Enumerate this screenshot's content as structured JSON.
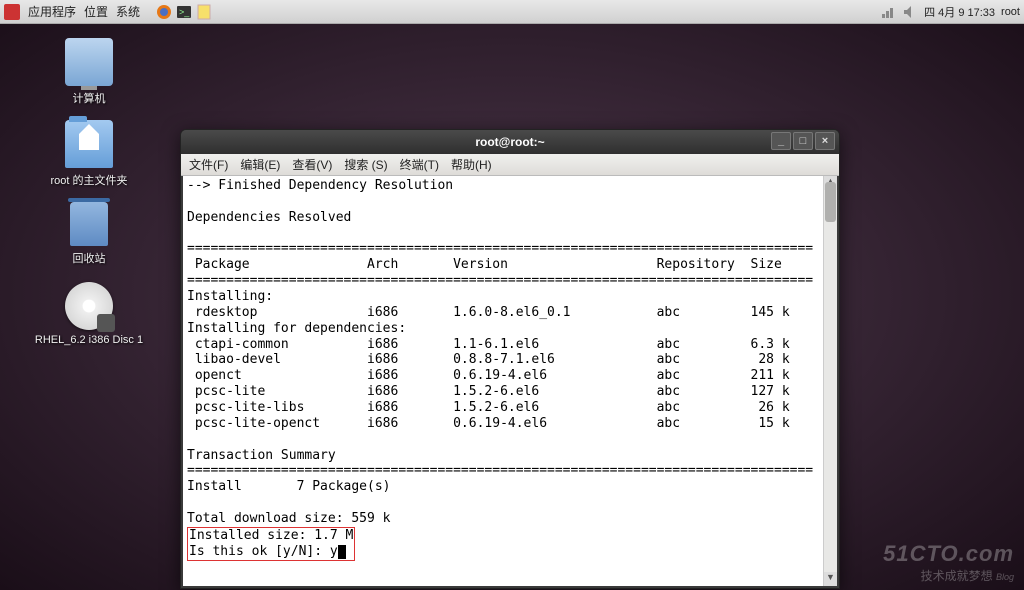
{
  "taskbar": {
    "menu": {
      "apps": "应用程序",
      "places": "位置",
      "system": "系统"
    },
    "clock": "四  4月  9 17:33",
    "user": "root"
  },
  "desktop": {
    "computer": "计算机",
    "home": "root 的主文件夹",
    "trash": "回收站",
    "dvd": "RHEL_6.2 i386 Disc 1"
  },
  "window": {
    "title": "root@root:~",
    "menu": {
      "file": "文件(F)",
      "edit": "编辑(E)",
      "view": "查看(V)",
      "search": "搜索 (S)",
      "terminal": "终端(T)",
      "help": "帮助(H)"
    }
  },
  "terminal": {
    "line_finish": "--> Finished Dependency Resolution",
    "deps_resolved": "Dependencies Resolved",
    "hdr": {
      "pkg": "Package",
      "arch": "Arch",
      "ver": "Version",
      "repo": "Repository",
      "size": "Size"
    },
    "install_hdr": "Installing:",
    "install_dep_hdr": "Installing for dependencies:",
    "rows": [
      {
        "p": "rdesktop",
        "a": "i686",
        "v": "1.6.0-8.el6_0.1",
        "r": "abc",
        "s": "145 k"
      },
      {
        "p": "ctapi-common",
        "a": "i686",
        "v": "1.1-6.1.el6",
        "r": "abc",
        "s": "6.3 k"
      },
      {
        "p": "libao-devel",
        "a": "i686",
        "v": "0.8.8-7.1.el6",
        "r": "abc",
        "s": " 28 k"
      },
      {
        "p": "openct",
        "a": "i686",
        "v": "0.6.19-4.el6",
        "r": "abc",
        "s": "211 k"
      },
      {
        "p": "pcsc-lite",
        "a": "i686",
        "v": "1.5.2-6.el6",
        "r": "abc",
        "s": "127 k"
      },
      {
        "p": "pcsc-lite-libs",
        "a": "i686",
        "v": "1.5.2-6.el6",
        "r": "abc",
        "s": " 26 k"
      },
      {
        "p": "pcsc-lite-openct",
        "a": "i686",
        "v": "0.6.19-4.el6",
        "r": "abc",
        "s": " 15 k"
      }
    ],
    "txn_summary": "Transaction Summary",
    "install_count": "Install       7 Package(s)",
    "dl_size": "Total download size: 559 k",
    "inst_size": "Installed size: 1.7 M",
    "prompt": "Is this ok [y/N]: ",
    "answer": "y"
  },
  "watermark": {
    "l1": "51CTO.com",
    "l2": "技术成就梦想",
    "blog": "Blog"
  }
}
